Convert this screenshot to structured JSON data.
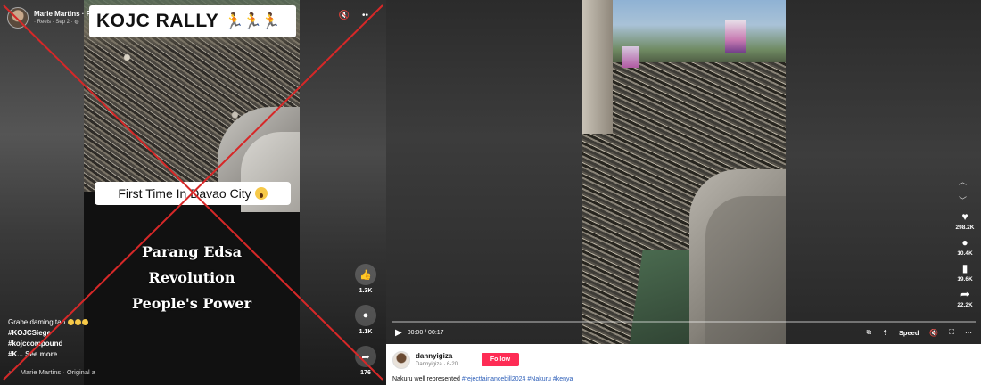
{
  "facebook": {
    "user_name": "Marie Martins · Follow",
    "post_meta": "· Reels · Sep 2 · ",
    "rally_title": "KOJC RALLY",
    "runners": "🏃🏃🏃",
    "first_time_text": "First Time In Davao City",
    "overlay_lines": [
      "Parang Edsa",
      "Revolution",
      "People's Power"
    ],
    "actions": [
      {
        "name": "like",
        "icon": "👍",
        "count": "1.3K"
      },
      {
        "name": "comment",
        "icon": "●",
        "count": "1.1K"
      },
      {
        "name": "share",
        "icon": "➦",
        "count": "176"
      }
    ],
    "caption_line1": "Grabe daming tao",
    "caption_tags": [
      "#KOJCSiege",
      "#kojccompound"
    ],
    "caption_more_prefix": "#K...",
    "see_more_label": "See more",
    "audio_label": "Marie Martins · Original a",
    "top_icons": [
      "mute-icon",
      "more-icon"
    ],
    "cross_color": "#d62828"
  },
  "tiktok": {
    "time": "00:00 / 00:17",
    "speed_label": "Speed",
    "actions": [
      {
        "name": "like",
        "icon": "♥",
        "count": "298.2K"
      },
      {
        "name": "comment",
        "icon": "●",
        "count": "10.4K"
      },
      {
        "name": "bookmark",
        "icon": "▮",
        "count": "19.6K"
      },
      {
        "name": "share",
        "icon": "➦",
        "count": "22.2K"
      }
    ],
    "username": "dannyigiza",
    "user_meta": "Dannyigiza · 6-20",
    "follow_label": "Follow",
    "description_text": "Nakuru well represented ",
    "description_tags": [
      "#rejectfainancebill2024",
      "#Nakuru",
      "#kenya"
    ],
    "follow_color": "#fe2c55",
    "tag_color": "#2b5db8"
  }
}
